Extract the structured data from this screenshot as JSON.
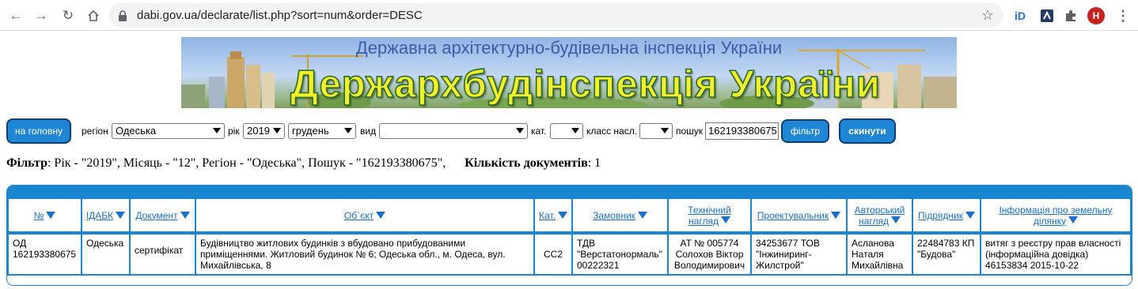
{
  "browser": {
    "url": "dabi.gov.ua/declarate/list.php?sort=num&order=DESC",
    "profile_initial": "H",
    "ext_label": "iD"
  },
  "banner": {
    "subtitle": "Державна архітектурно-будівельна інспекція України",
    "title": "Держархбудінспекція України"
  },
  "filters": {
    "home_button": "на головну",
    "region_label": "регіон",
    "region_value": "Одеська",
    "year_label": "рік",
    "year_value": "2019",
    "month_value": "грудень",
    "type_label": "вид",
    "type_value": "",
    "cat_label": "кат.",
    "cat_value": "",
    "class_label": "класс насл.",
    "class_value": "",
    "search_label": "пошук",
    "search_value": "162193380675",
    "filter_button": "фільтр",
    "reset_button": "скинути"
  },
  "summary": {
    "filter_label": "Фільтр",
    "filter_text": ": Рік - \"2019\", Місяць - \"12\", Регіон - \"Одеська\", Пошук - \"162193380675\",",
    "count_label": "Кількість документів",
    "count_value": ": 1"
  },
  "table": {
    "headers": [
      {
        "text": "№"
      },
      {
        "text": "ІДАБК"
      },
      {
        "text": "Документ"
      },
      {
        "text": "Об`єкт"
      },
      {
        "text": "Кат."
      },
      {
        "text": "Замовник"
      },
      {
        "line1": "Технічний",
        "line2": "нагляд"
      },
      {
        "text": "Проектувальник"
      },
      {
        "line1": "Авторський",
        "line2": "нагляд"
      },
      {
        "text": "Підрядник"
      },
      {
        "line1": "Інформація про земельну",
        "line2": "ділянку"
      }
    ],
    "rows": [
      {
        "num": "ОД 162193380675",
        "idabk": "Одеська",
        "doc": "сертифікат",
        "object": "Будівництво житлових будинків з вбудовано прибудованими приміщеннями. Житловий будинок № 6; Одеська обл., м. Одеса, вул. Михайлівська, 8",
        "cat": "СС2",
        "customer": "ТДВ \"Верстатонормаль\" 00222321",
        "tech": "АТ № 005774 Солохов Віктор Володимирович",
        "designer": "34253677 ТОВ \"Інжиниринг-Жилстрой\"",
        "author": "Асланова Наталя Михайлівна",
        "contractor": "22484783 КП \"Будова\"",
        "land": "витяг з реєстру прав власності (інформаційна довідка) 46153834 2015-10-22"
      }
    ]
  },
  "colors": {
    "accent": "#1a86d0",
    "button": "#1f86d6",
    "link": "#1a6fcf"
  }
}
